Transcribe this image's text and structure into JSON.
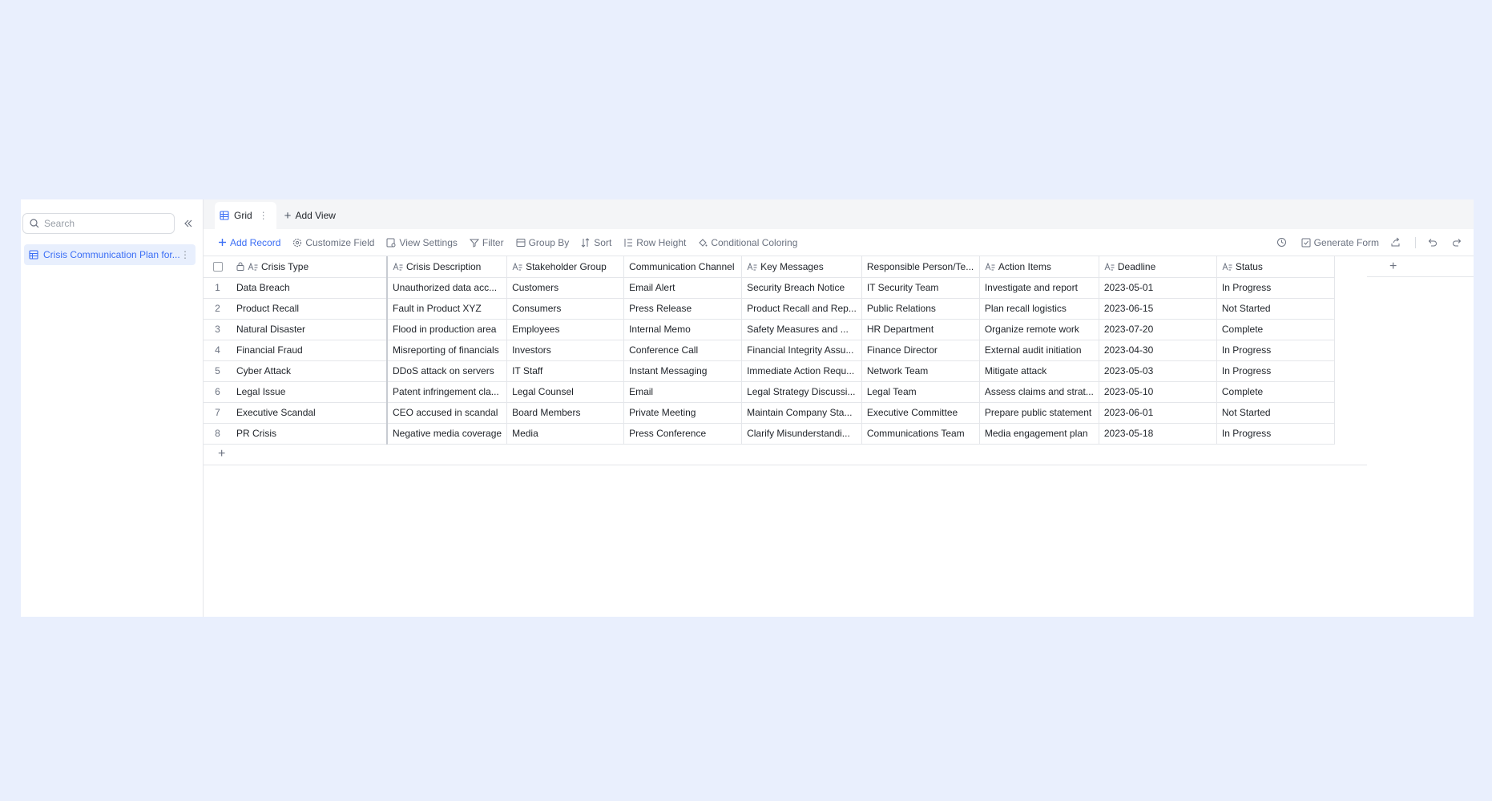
{
  "sidebar": {
    "search_placeholder": "Search",
    "table_name": "Crisis Communication Plan for..."
  },
  "views": {
    "active_tab": "Grid",
    "add_view_label": "Add View"
  },
  "toolbar": {
    "add_record": "Add Record",
    "customize_field": "Customize Field",
    "view_settings": "View Settings",
    "filter": "Filter",
    "group_by": "Group By",
    "sort": "Sort",
    "row_height": "Row Height",
    "conditional_coloring": "Conditional Coloring",
    "generate_form": "Generate Form"
  },
  "grid": {
    "columns": [
      "Crisis Type",
      "Crisis Description",
      "Stakeholder Group",
      "Communication Channel",
      "Key Messages",
      "Responsible Person/Te...",
      "Action Items",
      "Deadline",
      "Status"
    ],
    "rows": [
      {
        "num": "1",
        "cells": [
          "Data Breach",
          "Unauthorized data acc...",
          "Customers",
          "Email Alert",
          "Security Breach Notice",
          "IT Security Team",
          "Investigate and report",
          "2023-05-01",
          "In Progress"
        ]
      },
      {
        "num": "2",
        "cells": [
          "Product Recall",
          "Fault in Product XYZ",
          "Consumers",
          "Press Release",
          "Product Recall and Rep...",
          "Public Relations",
          "Plan recall logistics",
          "2023-06-15",
          "Not Started"
        ]
      },
      {
        "num": "3",
        "cells": [
          "Natural Disaster",
          "Flood in production area",
          "Employees",
          "Internal Memo",
          "Safety Measures and ...",
          "HR Department",
          "Organize remote work",
          "2023-07-20",
          "Complete"
        ]
      },
      {
        "num": "4",
        "cells": [
          "Financial Fraud",
          "Misreporting of financials",
          "Investors",
          "Conference Call",
          "Financial Integrity Assu...",
          "Finance Director",
          "External audit initiation",
          "2023-04-30",
          "In Progress"
        ]
      },
      {
        "num": "5",
        "cells": [
          "Cyber Attack",
          "DDoS attack on servers",
          "IT Staff",
          "Instant Messaging",
          "Immediate Action Requ...",
          "Network Team",
          "Mitigate attack",
          "2023-05-03",
          "In Progress"
        ]
      },
      {
        "num": "6",
        "cells": [
          "Legal Issue",
          "Patent infringement cla...",
          "Legal Counsel",
          "Email",
          "Legal Strategy Discussi...",
          "Legal Team",
          "Assess claims and strat...",
          "2023-05-10",
          "Complete"
        ]
      },
      {
        "num": "7",
        "cells": [
          "Executive Scandal",
          "CEO accused in scandal",
          "Board Members",
          "Private Meeting",
          "Maintain Company Sta...",
          "Executive Committee",
          "Prepare public statement",
          "2023-06-01",
          "Not Started"
        ]
      },
      {
        "num": "8",
        "cells": [
          "PR Crisis",
          "Negative media coverage",
          "Media",
          "Press Conference",
          "Clarify Misunderstandi...",
          "Communications Team",
          "Media engagement plan",
          "2023-05-18",
          "In Progress"
        ]
      }
    ]
  }
}
